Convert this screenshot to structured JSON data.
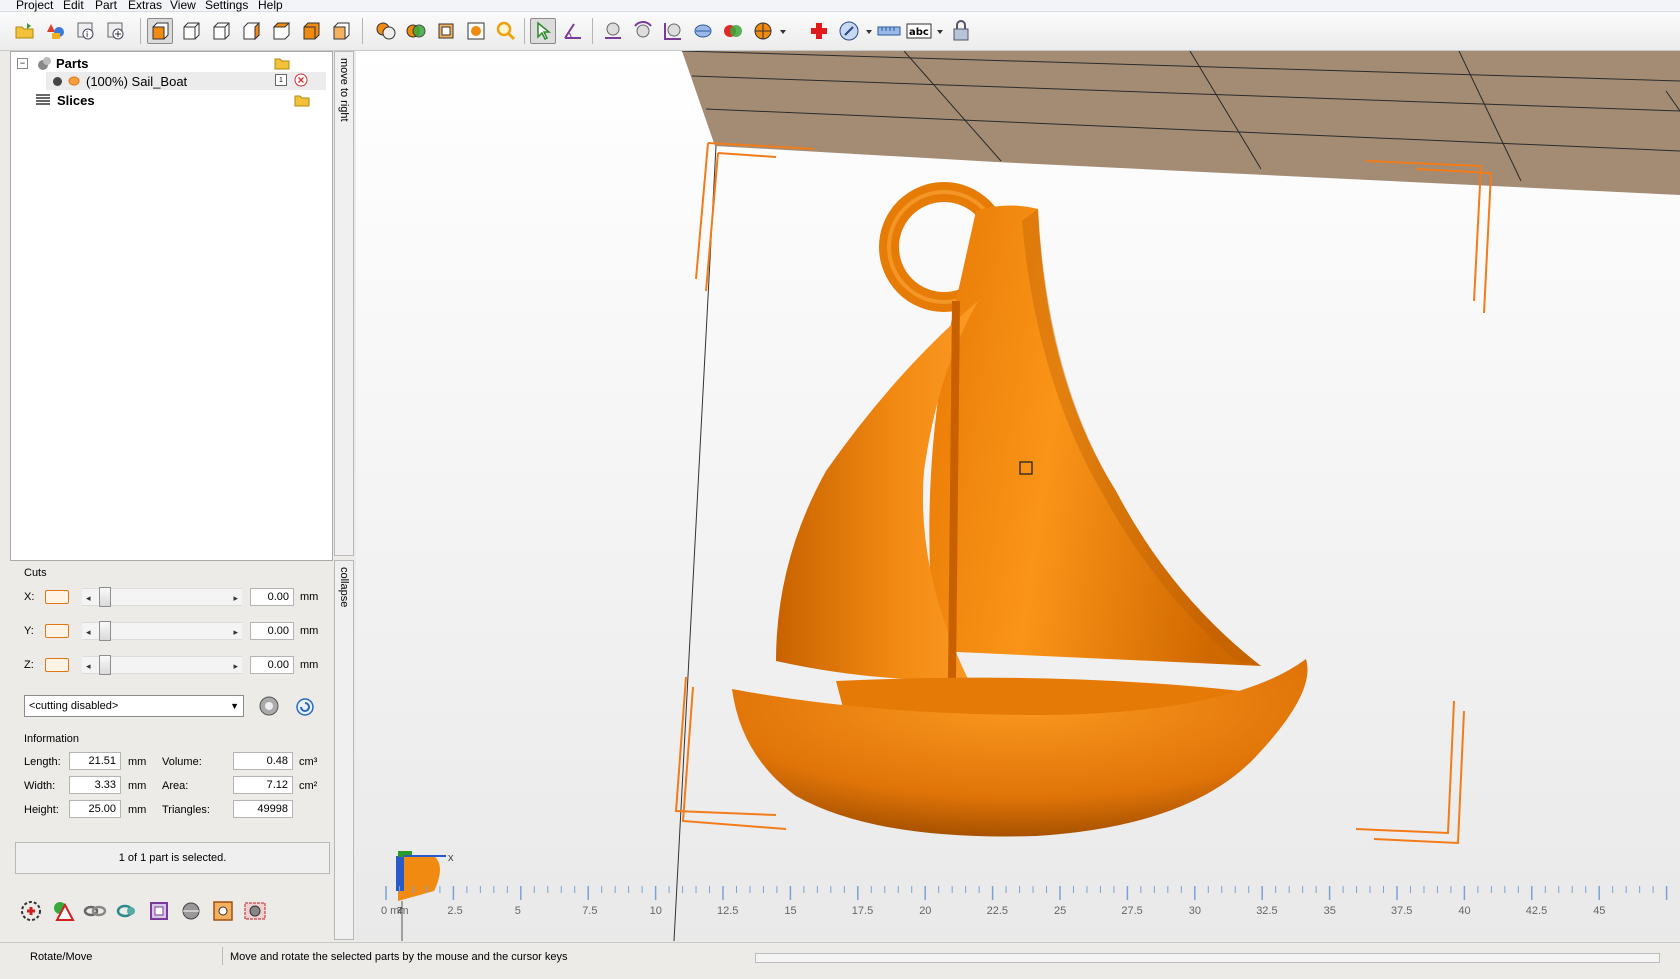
{
  "menu": [
    "Project",
    "Edit",
    "Part",
    "Extras",
    "View",
    "Settings",
    "Help"
  ],
  "toolbar": {
    "icons": [
      "open-folder-icon",
      "add-shapes-icon",
      "part-info-icon",
      "add-part-icon",
      "view-front-icon",
      "view-back-icon",
      "view-left-icon",
      "view-right-icon",
      "view-top-icon",
      "view-bottom-icon",
      "view-iso-icon",
      "merge-parts-icon",
      "duplicate-parts-icon",
      "fit-box-icon",
      "fit-view-icon",
      "zoom-icon",
      "select-pointer-icon",
      "measure-angle-icon",
      "place-on-platform-icon",
      "rotate-part-icon",
      "scale-part-icon",
      "mirror-part-icon",
      "boolean-icon",
      "wall-thickness-icon",
      "repair-cross-icon",
      "mesh-quality-icon",
      "ruler-icon",
      "label-abc-icon",
      "lock-part-icon"
    ]
  },
  "tree": {
    "parts_label": "Parts",
    "part_item": "(100%) Sail_Boat",
    "part_item_count": "1",
    "slices_label": "Slices"
  },
  "side_tabs": {
    "move_to_right": "move to right",
    "collapse": "collapse"
  },
  "cuts": {
    "title": "Cuts",
    "rows": [
      {
        "axis": "X:",
        "value": "0.00",
        "unit": "mm"
      },
      {
        "axis": "Y:",
        "value": "0.00",
        "unit": "mm"
      },
      {
        "axis": "Z:",
        "value": "0.00",
        "unit": "mm"
      }
    ],
    "mode": "<cutting disabled>"
  },
  "info": {
    "title": "Information",
    "length_label": "Length:",
    "length": "21.51",
    "length_unit": "mm",
    "width_label": "Width:",
    "width": "3.33",
    "width_unit": "mm",
    "height_label": "Height:",
    "height": "25.00",
    "height_unit": "mm",
    "volume_label": "Volume:",
    "volume": "0.48",
    "volume_unit": "cm³",
    "area_label": "Area:",
    "area": "7.12",
    "area_unit": "cm²",
    "triangles_label": "Triangles:",
    "triangles": "49998"
  },
  "selection_status": "1 of 1 part is selected.",
  "bottom_icons": [
    "repair-wheel-icon",
    "warning-icon",
    "link-icon",
    "refresh-parts-icon",
    "slice-frame-icon",
    "sphere-icon",
    "target-square-icon",
    "gear-grid-icon"
  ],
  "ruler": {
    "labels": [
      "0 mm",
      "2.5",
      "5",
      "7.5",
      "10",
      "12.5",
      "15",
      "17.5",
      "20",
      "22.5",
      "25",
      "27.5",
      "30",
      "32.5",
      "35",
      "37.5",
      "40",
      "42.5",
      "45"
    ],
    "axis_x": "x",
    "axis_z": "z"
  },
  "statusbar": {
    "mode": "Rotate/Move",
    "hint": "Move and rotate the selected parts by the mouse and the cursor keys"
  },
  "colors": {
    "part_orange": "#f08a10",
    "floor": "#a48c74",
    "accent_select": "#f27b1a"
  }
}
